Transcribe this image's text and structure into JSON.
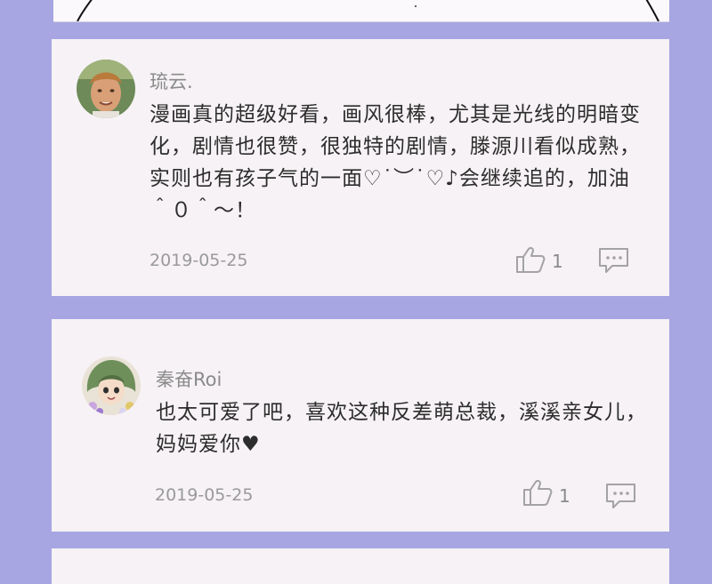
{
  "comments": [
    {
      "username": "琉云.",
      "avatar_icon": "avatar-photo-man",
      "content": "漫画真的超级好看，画风很棒，尤其是光线的明暗变化，剧情也很赞，很独特的剧情，滕源川看似成熟，实则也有孩子气的一面♡˙︶˙♡♪会继续追的，加油＾０＾～！",
      "date": "2019-05-25",
      "likes": "1",
      "like_icon": "thumbs-up-icon",
      "reply_icon": "comment-icon"
    },
    {
      "username": "秦奋Roi",
      "avatar_icon": "avatar-anime-character",
      "content": "也太可爱了吧，喜欢这种反差萌总裁，溪溪亲女儿，妈妈爱你♥",
      "date": "2019-05-25",
      "likes": "1",
      "like_icon": "thumbs-up-icon",
      "reply_icon": "comment-icon"
    }
  ],
  "colors": {
    "background": "#a7a6e2",
    "card": "#f6f2f5",
    "text": "#2d2d2d",
    "meta": "#9a9a9a"
  }
}
